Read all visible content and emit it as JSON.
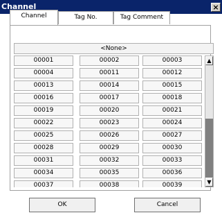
{
  "window": {
    "title": "Channel",
    "close_glyph": "×"
  },
  "tabs": [
    {
      "label": "Channel",
      "active": true
    },
    {
      "label": "Tag No.",
      "active": false
    },
    {
      "label": "Tag Comment",
      "active": false
    }
  ],
  "none_label": "<None>",
  "channels": [
    "00001",
    "00002",
    "00003",
    "00004",
    "00011",
    "00012",
    "00013",
    "00014",
    "00015",
    "00016",
    "00017",
    "00018",
    "00019",
    "00020",
    "00021",
    "00022",
    "00023",
    "00024",
    "00025",
    "00026",
    "00027",
    "00028",
    "00029",
    "00030",
    "00031",
    "00032",
    "00033",
    "00034",
    "00035",
    "00036",
    "00037",
    "00038",
    "00039"
  ],
  "scrollbar": {
    "up_icon": "up-arrow-icon",
    "down_icon": "down-arrow-icon"
  },
  "buttons": {
    "ok_label": "OK",
    "cancel_label": "Cancel"
  },
  "colors": {
    "titlebar": "#0a246a",
    "scroll_thumb": "#808080"
  }
}
